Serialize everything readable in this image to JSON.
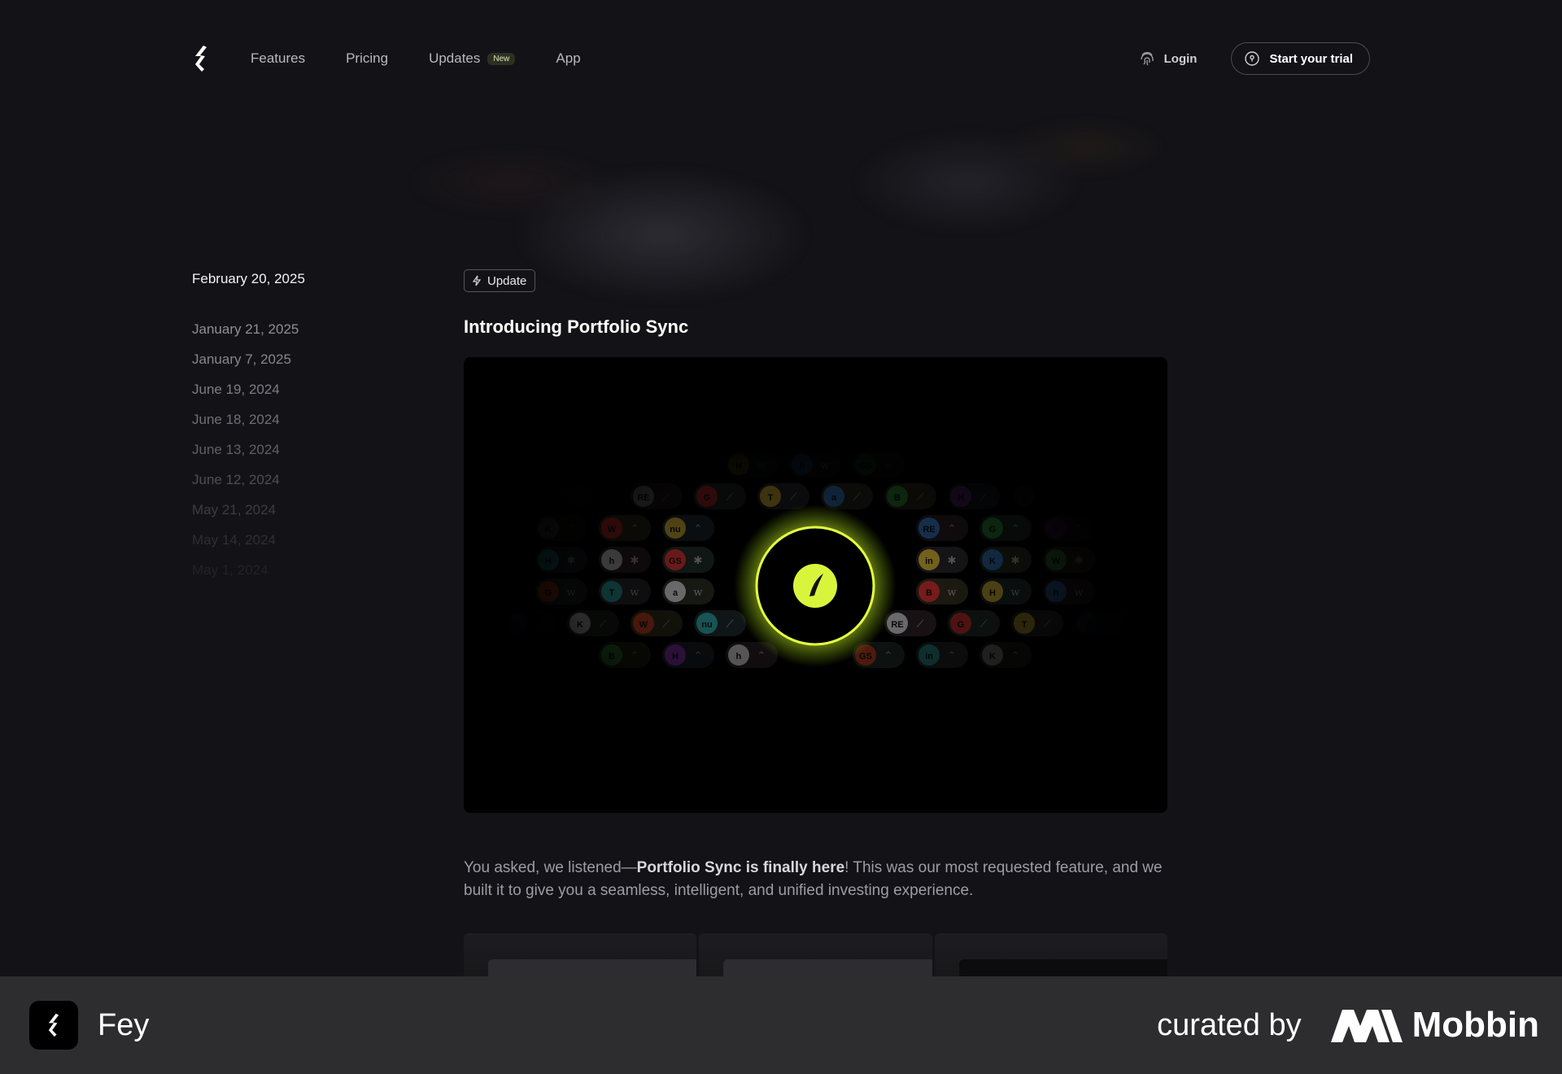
{
  "nav": {
    "links": [
      {
        "label": "Features"
      },
      {
        "label": "Pricing"
      },
      {
        "label": "Updates",
        "badge": "New"
      },
      {
        "label": "App"
      }
    ],
    "login": "Login",
    "trial": "Start your trial"
  },
  "sidebar": {
    "active": "February 20, 2025",
    "dates": [
      "January 21, 2025",
      "January 7, 2025",
      "June 19, 2024",
      "June 18, 2024",
      "June 13, 2024",
      "June 12, 2024",
      "May 21, 2024",
      "May 14, 2024",
      "May 1, 2024"
    ]
  },
  "post": {
    "tag": "Update",
    "title": "Introducing Portfolio Sync",
    "body_prefix": "You asked, we listened—",
    "body_bold": "Portfolio Sync is finally here",
    "body_suffix": "! This was our most requested feature, and we built it to give you a seamless, intelligent, and unified investing experience."
  },
  "hero_tickers": [
    "a",
    "B",
    "H",
    "h",
    "GS",
    "intel",
    "K",
    "W",
    "nu",
    "RELX",
    "G",
    "T"
  ],
  "footer": {
    "app_name": "Fey",
    "curated_by": "curated by",
    "brand": "Mobbin"
  },
  "colors": {
    "accent": "#d9f53b",
    "background": "#131317",
    "footer_bg": "#2d2d2f"
  }
}
